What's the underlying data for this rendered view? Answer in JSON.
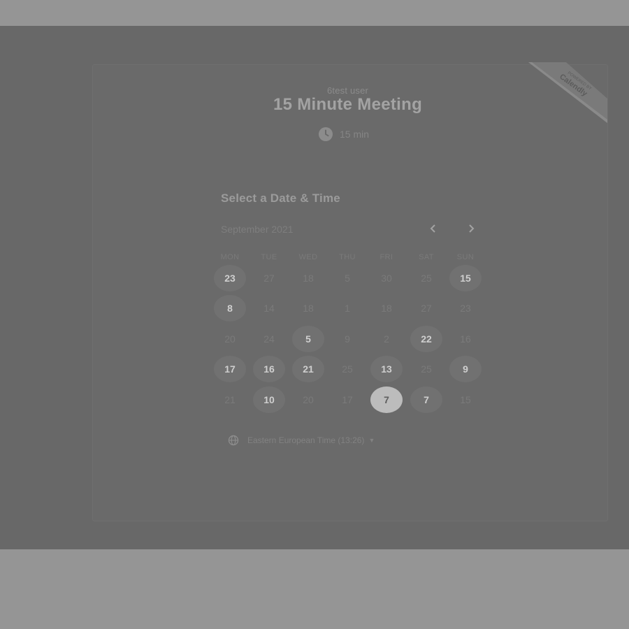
{
  "event": {
    "organizer": "6test user",
    "title": "15 Minute Meeting",
    "duration": "15 min"
  },
  "calendar": {
    "heading": "Select a Date & Time",
    "month": "September 2021",
    "weekdays": [
      "MON",
      "TUE",
      "WED",
      "THU",
      "FRI",
      "SAT",
      "SUN"
    ],
    "weeks": [
      [
        {
          "d": "23",
          "s": "available"
        },
        {
          "d": "27"
        },
        {
          "d": "18"
        },
        {
          "d": "5"
        },
        {
          "d": "30"
        },
        {
          "d": "25"
        },
        {
          "d": "15",
          "s": "available"
        }
      ],
      [
        {
          "d": "8",
          "s": "available"
        },
        {
          "d": "14"
        },
        {
          "d": "18"
        },
        {
          "d": "1"
        },
        {
          "d": "18"
        },
        {
          "d": "27"
        },
        {
          "d": "23"
        }
      ],
      [
        {
          "d": "20"
        },
        {
          "d": "24"
        },
        {
          "d": "5",
          "s": "available"
        },
        {
          "d": "9"
        },
        {
          "d": "2"
        },
        {
          "d": "22",
          "s": "available"
        },
        {
          "d": "16"
        }
      ],
      [
        {
          "d": "17",
          "s": "available"
        },
        {
          "d": "16",
          "s": "available"
        },
        {
          "d": "21",
          "s": "available"
        },
        {
          "d": "25"
        },
        {
          "d": "13",
          "s": "available"
        },
        {
          "d": "25"
        },
        {
          "d": "9",
          "s": "available"
        }
      ],
      [
        {
          "d": "21"
        },
        {
          "d": "10",
          "s": "available"
        },
        {
          "d": "20"
        },
        {
          "d": "17"
        },
        {
          "d": "7",
          "s": "selected"
        },
        {
          "d": "7",
          "s": "available"
        },
        {
          "d": "15"
        }
      ]
    ]
  },
  "timezone": {
    "label": "Eastern European Time (13:26)"
  },
  "badge": {
    "line1": "POWERED BY",
    "line2": "Calendly"
  },
  "icons": {
    "clock": "clock-icon",
    "globe": "globe-icon",
    "prev": "chevron-left-icon",
    "next": "chevron-right-icon",
    "caret": "caret-down-icon"
  }
}
